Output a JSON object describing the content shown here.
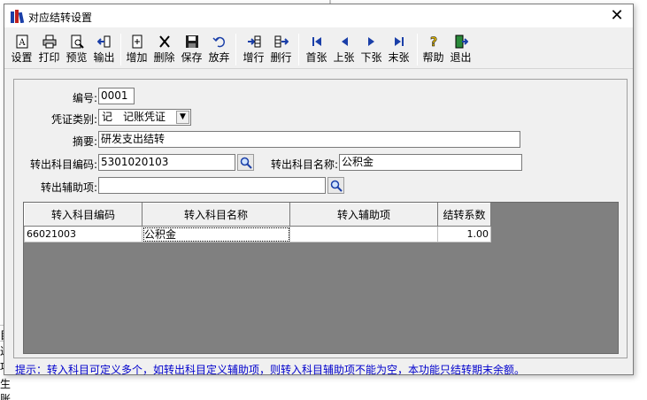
{
  "window": {
    "title": "对应结转设置",
    "close_glyph": "✕"
  },
  "background_app": {
    "fragments": [
      "目",
      "过",
      "项",
      "生账"
    ]
  },
  "toolbar": {
    "buttons": [
      {
        "label": "设置",
        "icon": "settings-icon"
      },
      {
        "label": "打印",
        "icon": "printer-icon"
      },
      {
        "label": "预览",
        "icon": "preview-icon"
      },
      {
        "label": "输出",
        "icon": "export-icon"
      },
      {
        "label": "增加",
        "icon": "add-icon"
      },
      {
        "label": "删除",
        "icon": "delete-icon"
      },
      {
        "label": "保存",
        "icon": "save-icon"
      },
      {
        "label": "放弃",
        "icon": "undo-icon"
      },
      {
        "label": "增行",
        "icon": "insert-row-icon"
      },
      {
        "label": "删行",
        "icon": "delete-row-icon"
      },
      {
        "label": "首张",
        "icon": "first-record-icon"
      },
      {
        "label": "上张",
        "icon": "previous-record-icon"
      },
      {
        "label": "下张",
        "icon": "next-record-icon"
      },
      {
        "label": "末张",
        "icon": "last-record-icon"
      },
      {
        "label": "帮助",
        "icon": "help-icon"
      },
      {
        "label": "退出",
        "icon": "exit-icon"
      }
    ]
  },
  "form": {
    "number_label": "编号:",
    "number_value": "0001",
    "voucher_type_label": "凭证类别:",
    "voucher_type_value": "记　记账凭证",
    "summary_label": "摘要:",
    "summary_value": "研发支出结转",
    "out_code_label": "转出科目编码:",
    "out_code_value": "5301020103",
    "out_name_label": "转出科目名称:",
    "out_name_value": "公积金",
    "out_aux_label": "转出辅助项:",
    "out_aux_value": ""
  },
  "grid": {
    "columns": [
      "转入科目编码",
      "转入科目名称",
      "转入辅助项",
      "结转系数"
    ],
    "rows": [
      {
        "code": "66021003",
        "name": "公积金",
        "aux": "",
        "coef": "1.00"
      }
    ]
  },
  "hint": "提示：转入科目可定义多个，如转出科目定义辅助项，则转入科目辅助项不能为空，本功能只结转期末余额。",
  "colors": {
    "hint_text": "#0000cc",
    "grid_background": "#808080",
    "dialog_background": "#f0f0f0"
  }
}
